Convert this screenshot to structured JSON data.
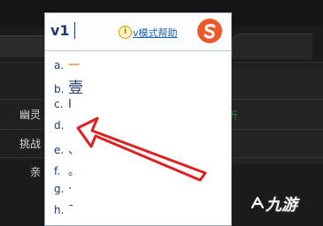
{
  "ime": {
    "input": "v1",
    "help_link": "v模式帮助",
    "help_icon": "info-icon",
    "logo_icon": "sogou-s-icon",
    "candidates": [
      {
        "letter": "a.",
        "char": "一"
      },
      {
        "letter": "b.",
        "char": "壹"
      },
      {
        "letter": "c.",
        "char": "Ⅰ"
      },
      {
        "letter": "d.",
        "char": ""
      },
      {
        "letter": "e.",
        "char": "、"
      },
      {
        "letter": "f.",
        "char": "。"
      },
      {
        "letter": "g.",
        "char": "·"
      },
      {
        "letter": "h.",
        "char": "ˉ"
      }
    ]
  },
  "background": {
    "labels": [
      "幽灵",
      "挑战",
      "亲"
    ],
    "green_text": "沂"
  },
  "watermark": {
    "text": "九游",
    "icon": "jiuyou-logo-icon"
  },
  "colors": {
    "arrow": "#e02020",
    "ime_text": "#1f3b6e",
    "link": "#1f5faa",
    "logo": "#ec5a2b"
  }
}
